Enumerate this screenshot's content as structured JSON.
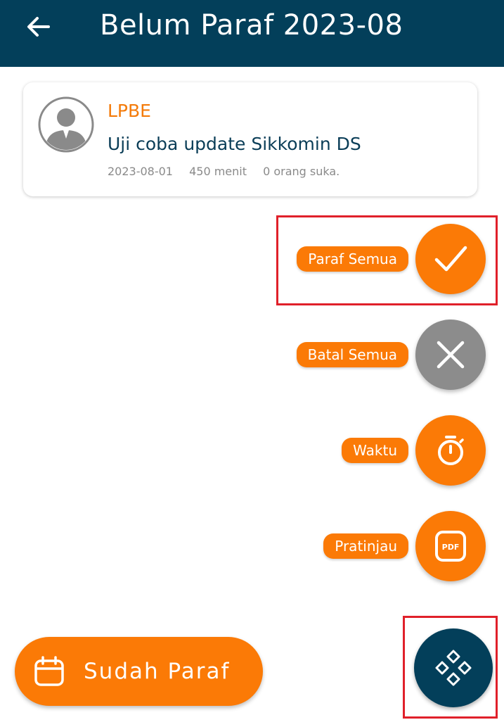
{
  "appbar": {
    "title": "Belum Paraf 2023-08"
  },
  "card": {
    "org": "LPBE",
    "title": "Uji coba update Sikkomin DS",
    "date": "2023-08-01",
    "duration": "450 menit",
    "likes": "0 orang suka."
  },
  "actions": [
    {
      "label": "Paraf Semua",
      "icon": "check-icon",
      "color": "#fb7a06"
    },
    {
      "label": "Batal Semua",
      "icon": "close-icon",
      "color": "#8c8c8c"
    },
    {
      "label": "Waktu",
      "icon": "stopwatch-icon",
      "color": "#fb7a06"
    },
    {
      "label": "Pratinjau",
      "icon": "pdf-icon",
      "color": "#fb7a06",
      "icon_text": "PDF"
    }
  ],
  "sudah_button": {
    "label": "Sudah Paraf",
    "icon": "calendar-icon"
  },
  "main_fab": {
    "icon": "diamond-grid-icon"
  },
  "colors": {
    "primary": "#033f5a",
    "accent": "#fb7a06",
    "highlight": "#e0202a"
  }
}
